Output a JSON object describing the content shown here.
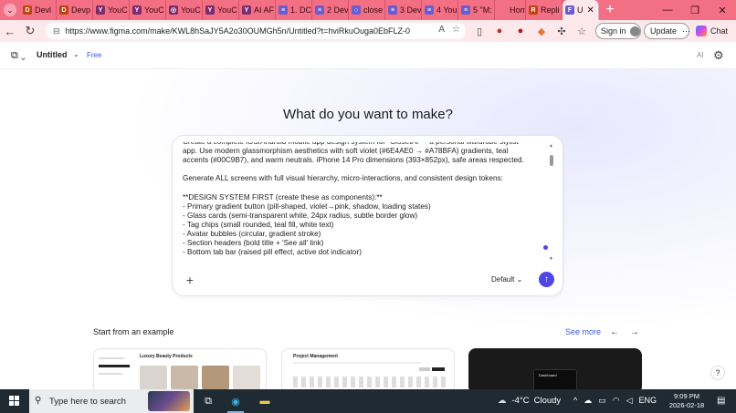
{
  "browser": {
    "tabs": [
      {
        "label": "Devl",
        "color": "#c2410c",
        "glyph": "D"
      },
      {
        "label": "Devp",
        "color": "#c2410c",
        "glyph": "D"
      },
      {
        "label": "YouC",
        "color": "#7c2d6b",
        "glyph": "Y"
      },
      {
        "label": "YouC",
        "color": "#7c2d6b",
        "glyph": "Y"
      },
      {
        "label": "YouC",
        "color": "#7c2d6b",
        "glyph": "◎"
      },
      {
        "label": "YouC",
        "color": "#7c2d6b",
        "glyph": "Y"
      },
      {
        "label": "AI AF",
        "color": "#7c2d6b",
        "glyph": "Y"
      },
      {
        "label": "1. DC",
        "color": "#6d5bd0",
        "glyph": "≡"
      },
      {
        "label": "2 Dev",
        "color": "#6d5bd0",
        "glyph": "≡"
      },
      {
        "label": "close",
        "color": "#6d5bd0",
        "glyph": "○"
      },
      {
        "label": "3 Dev",
        "color": "#6d5bd0",
        "glyph": "≡"
      },
      {
        "label": "4 You",
        "color": "#6d5bd0",
        "glyph": "≡"
      },
      {
        "label": "5 \"M:",
        "color": "#6d5bd0",
        "glyph": "≡"
      },
      {
        "label": "Home",
        "color": "#f26f84",
        "glyph": ""
      },
      {
        "label": "Repli",
        "color": "#c2410c",
        "glyph": "R"
      },
      {
        "label": "U",
        "color": "#6d5bd0",
        "glyph": "F",
        "active": true
      }
    ],
    "url": "https://www.figma.com/make/KWL8hSaJY5A2o30OUMGh5n/Untitled?t=hviRkuOuga0EbFLZ-0",
    "signin_label": "Sign in",
    "update_label": "Update",
    "chat_label": "Chat"
  },
  "app": {
    "file_name": "Untitled",
    "plan_badge": "Free",
    "ai_label": "AI"
  },
  "main": {
    "heading": "What do you want to make?",
    "prompt_lines": [
      "Create a complete iOS/Android mobile app design system for \"ClosetAI\" – a personal wardrobe stylist",
      "app. Use modern glassmorphism aesthetics with soft violet (#6E4AE0 → #A78BFA) gradients, teal",
      "accents (#00C9B7), and warm neutrals. iPhone 14 Pro dimensions (393×852px), safe areas respected.",
      "",
      "Generate ALL screens with full visual hierarchy, micro-interactions, and consistent design tokens:",
      "",
      "**DESIGN SYSTEM FIRST (create these as components):**",
      "- Primary gradient button (pill-shaped, violet→pink, shadow, loading states)",
      "- Glass cards (semi-transparent white, 24px radius, subtle border glow)",
      "- Tag chips (small rounded, teal fill, white text)",
      "- Avatar bubbles (circular, gradient stroke)",
      "- Section headers (bold title + 'See all' link)",
      "- Bottom tab bar (raised pill effect, active dot indicator)"
    ],
    "model_label": "Default",
    "examples_title": "Start from an example",
    "see_more": "See more",
    "example_cards": [
      {
        "title": "Luxury Beauty Products"
      },
      {
        "title": "Project Management"
      },
      {
        "title": "Dashboard"
      }
    ]
  },
  "taskbar": {
    "search_placeholder": "Type here to search",
    "temperature": "-4°C",
    "weather": "Cloudy",
    "language": "ENG",
    "time": "9:09 PM",
    "date": "2026-02-18"
  }
}
